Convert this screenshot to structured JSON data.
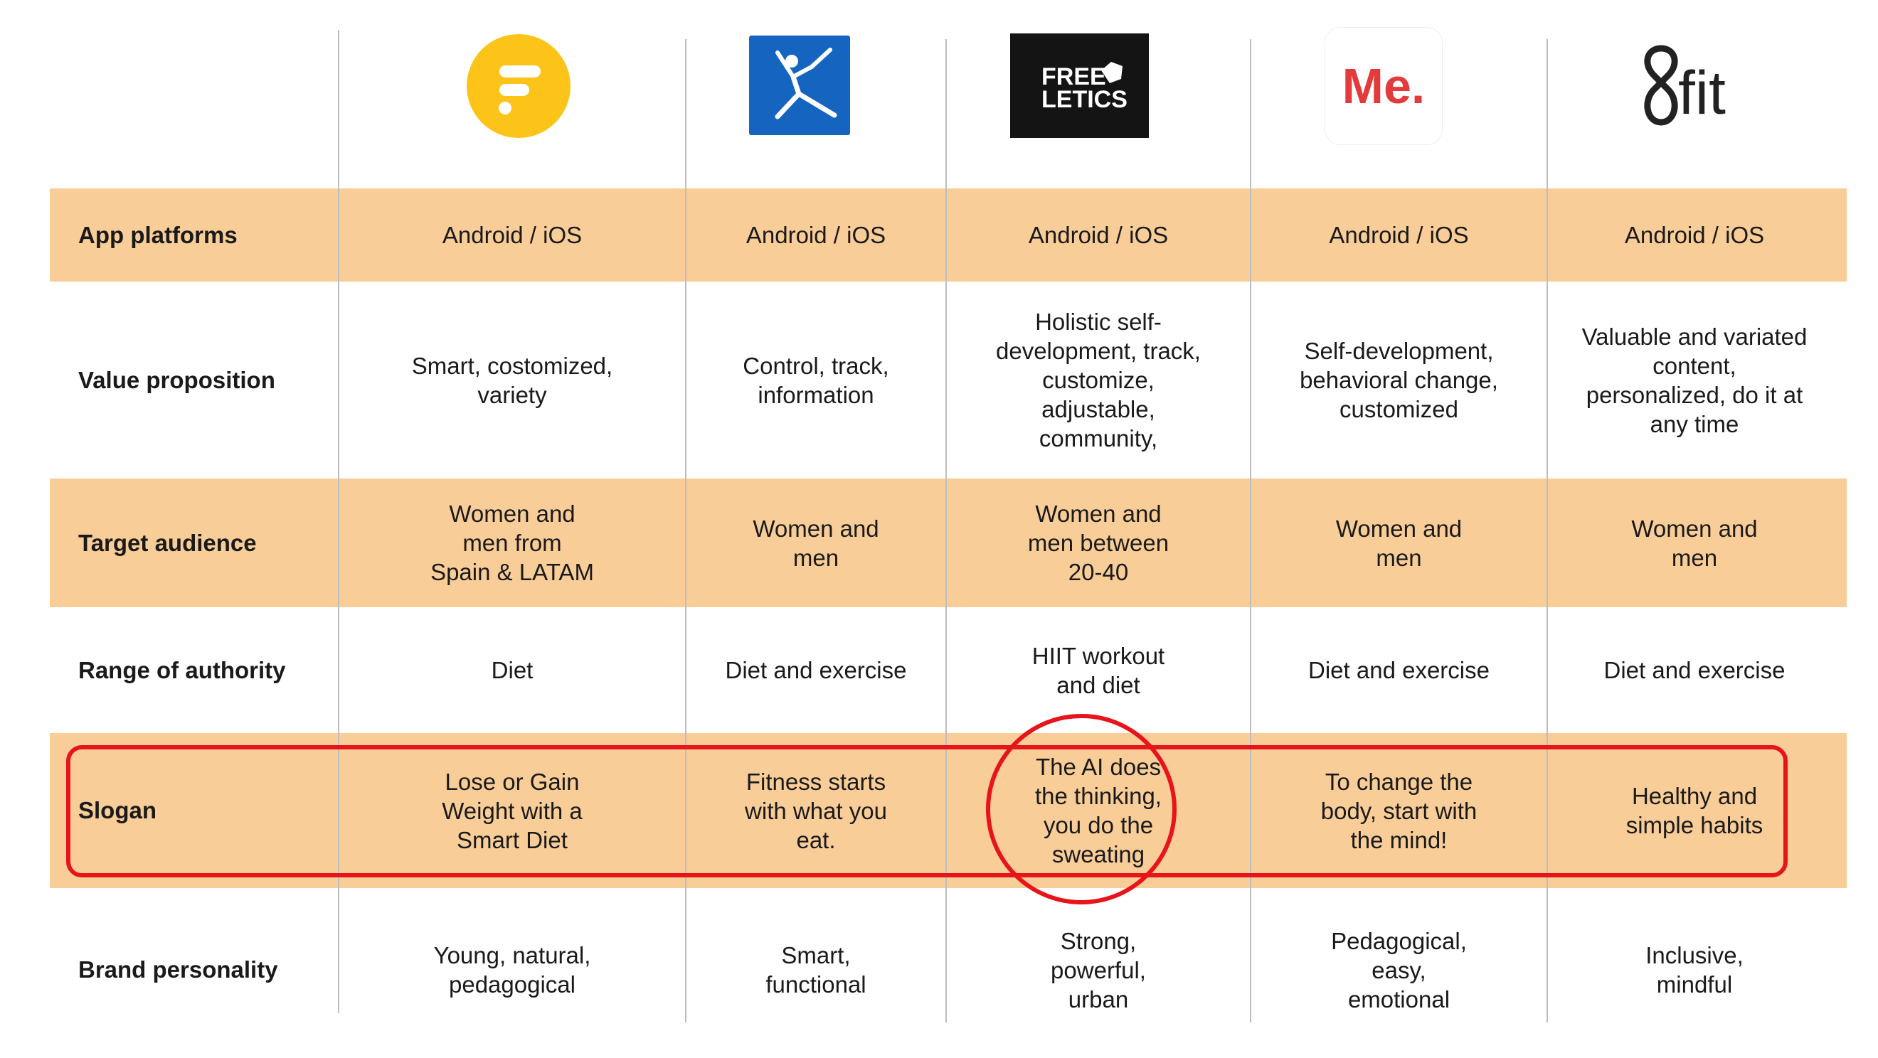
{
  "logos": [
    {
      "name": "fitia",
      "text": ""
    },
    {
      "name": "myfitnesspal",
      "text": ""
    },
    {
      "name": "freeletics",
      "text": "FREE LETICS"
    },
    {
      "name": "me",
      "text": "Me."
    },
    {
      "name": "8fit",
      "text": "8fit"
    }
  ],
  "colors": {
    "band": "#f9cd98",
    "highlight": "#e8141b",
    "fitia_yellow": "#fcc419",
    "mfp_blue": "#1565c0",
    "me_red": "#e33b3b"
  },
  "rows": [
    {
      "label": "App platforms",
      "cells": [
        "Android / iOS",
        "Android / iOS",
        "Android / iOS",
        "Android / iOS",
        "Android / iOS"
      ]
    },
    {
      "label": "Value proposition",
      "cells": [
        "Smart, costomized,\nvariety",
        "Control, track,\ninformation",
        "Holistic self-\ndevelopment, track,\ncustomize,\nadjustable,\ncommunity,",
        "Self-development,\nbehavioral change,\ncustomized",
        "Valuable and variated\ncontent,\npersonalized, do it at\nany time"
      ]
    },
    {
      "label": "Target audience",
      "cells": [
        "Women and\nmen from\nSpain & LATAM",
        "Women and\nmen",
        "Women and\nmen between\n20-40",
        "Women and\nmen",
        "Women and\nmen"
      ]
    },
    {
      "label": "Range of authority",
      "cells": [
        "Diet",
        "Diet and exercise",
        "HIIT workout\nand diet",
        "Diet and exercise",
        "Diet and exercise"
      ]
    },
    {
      "label": "Slogan",
      "cells": [
        "Lose or Gain\nWeight with a\nSmart Diet",
        "Fitness starts\nwith what you\neat.",
        "The AI does\nthe thinking,\nyou do the\nsweating",
        "To change the\nbody, start with\nthe mind!",
        "Healthy and\nsimple habits"
      ]
    },
    {
      "label": "Brand personality",
      "cells": [
        "Young, natural,\npedagogical",
        "Smart,\nfunctional",
        "Strong,\npowerful,\nurban",
        "Pedagogical,\neasy,\nemotional",
        "Inclusive,\nmindful"
      ]
    }
  ]
}
